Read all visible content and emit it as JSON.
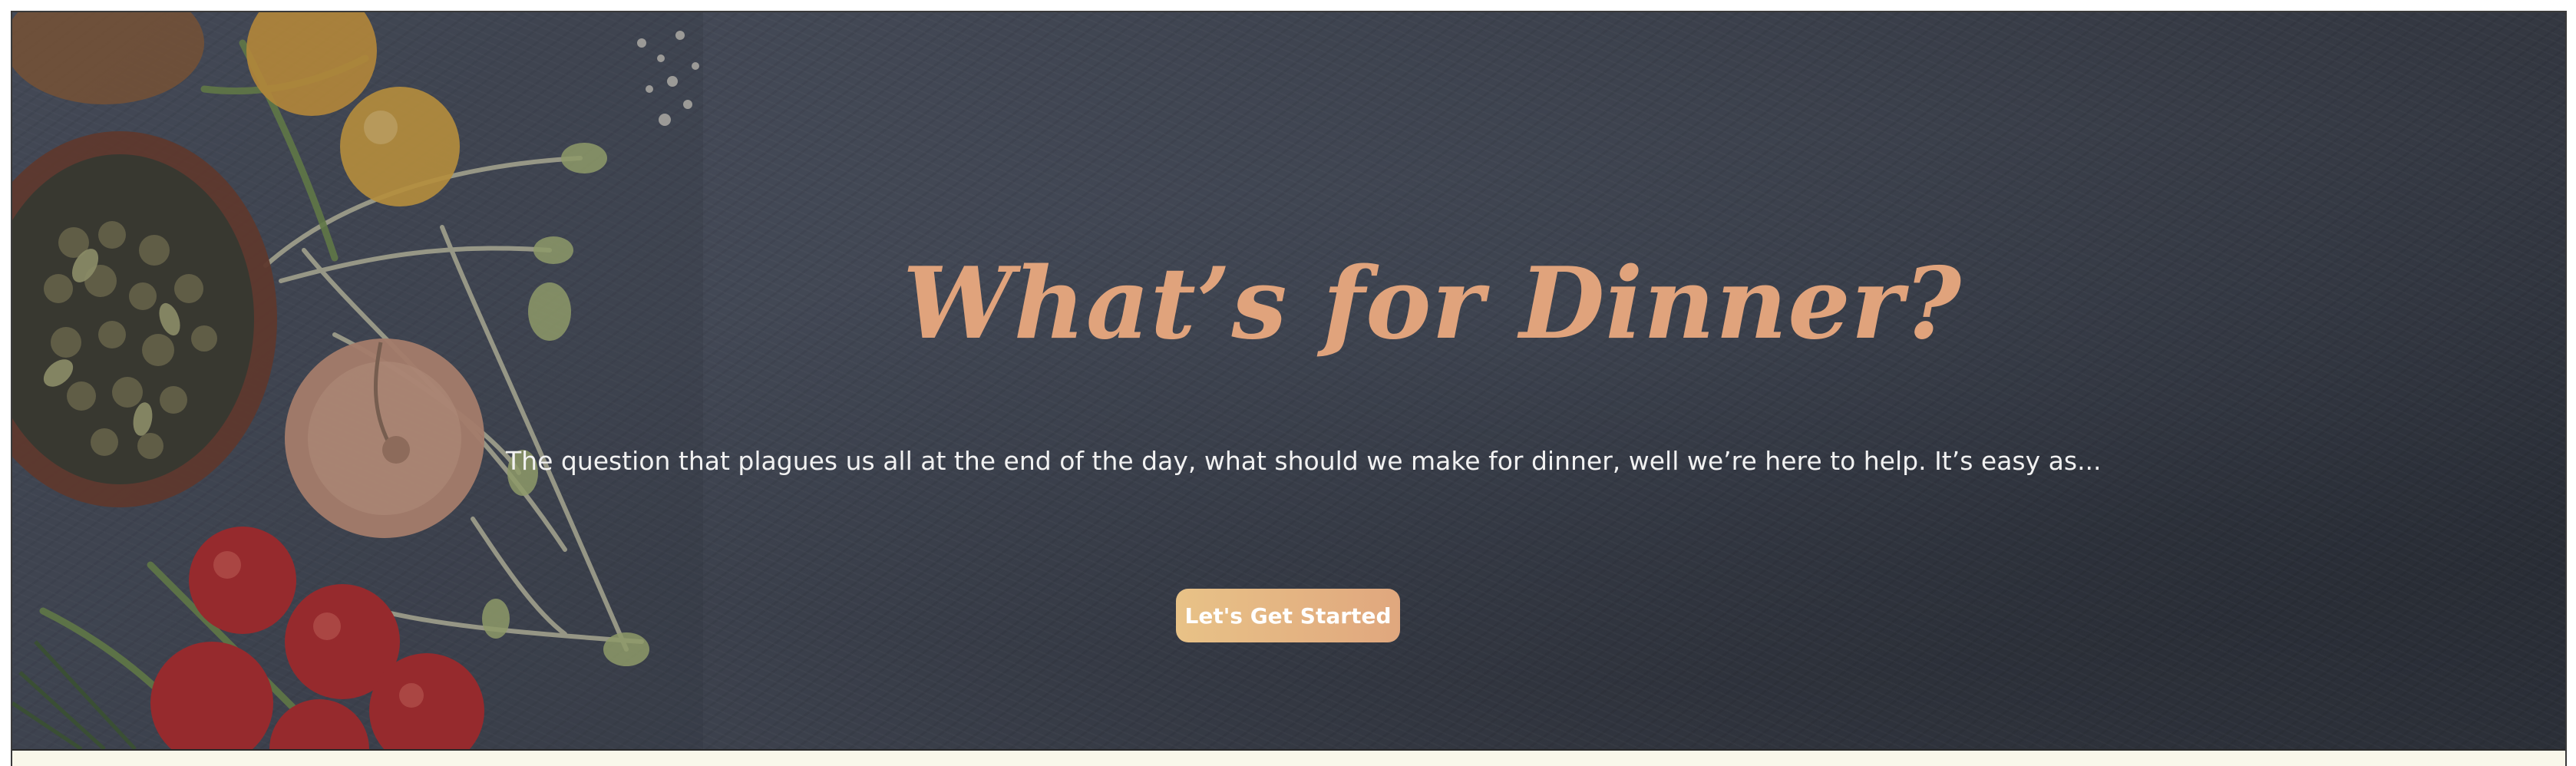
{
  "hero": {
    "title": "What’s for Dinner?",
    "subtitle": "The question that plagues us all at the end of the day, what should we make for dinner, well we’re here to help. It’s easy as...",
    "cta_label": "Let's Get Started"
  },
  "colors": {
    "title": "#e0a37c",
    "cta_start": "#e8c287",
    "cta_end": "#e0a77e",
    "background": "#3d424e",
    "bottom_strip": "#f9f7ea"
  },
  "icons": {
    "decor": "vegetables-food-illustration"
  }
}
